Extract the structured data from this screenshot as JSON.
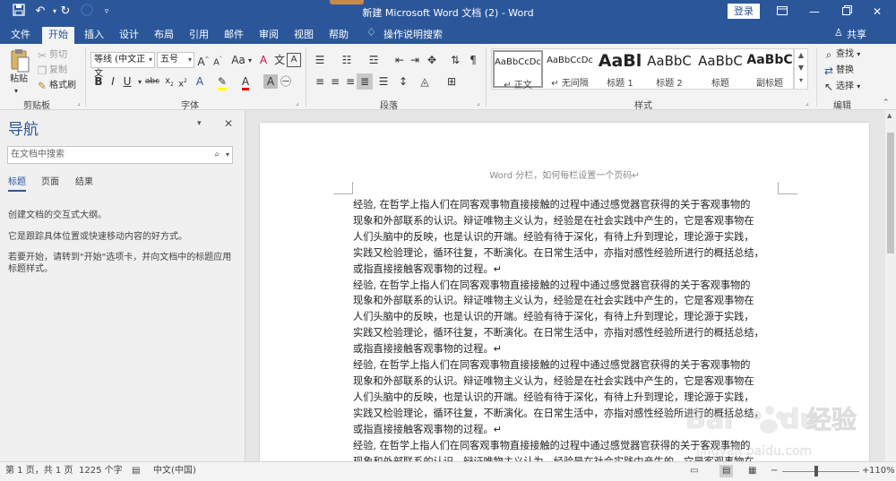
{
  "titlebar": {
    "title": "新建 Microsoft Word 文档 (2)  -  Word",
    "login": "登录",
    "quick_access": [
      "save-icon",
      "undo-icon",
      "redo-icon",
      "touch-mode-icon",
      "customize-icon"
    ]
  },
  "tabs": [
    "文件",
    "开始",
    "插入",
    "设计",
    "布局",
    "引用",
    "邮件",
    "审阅",
    "视图",
    "帮助"
  ],
  "active_tab": "开始",
  "tell_me": "操作说明搜索",
  "share": "共享",
  "ribbon": {
    "clipboard": {
      "label": "剪贴板",
      "paste": "粘贴",
      "cut": "剪切",
      "copy": "复制",
      "format_painter": "格式刷"
    },
    "font": {
      "label": "字体",
      "font_name": "等线 (中文正文",
      "font_size": "五号",
      "aa": "Aa"
    },
    "paragraph": {
      "label": "段落"
    },
    "styles": {
      "label": "样式",
      "items": [
        {
          "preview": "AaBbCcDc",
          "name": "正文"
        },
        {
          "preview": "AaBbCcDc",
          "name": "无间隔"
        },
        {
          "preview": "AaBl",
          "name": "标题 1"
        },
        {
          "preview": "AaBbC",
          "name": "标题 2"
        },
        {
          "preview": "AaBbC",
          "name": "标题"
        },
        {
          "preview": "AaBbC",
          "name": "副标题"
        }
      ]
    },
    "editing": {
      "label": "编辑",
      "find": "查找",
      "replace": "替换",
      "select": "选择"
    }
  },
  "nav": {
    "title": "导航",
    "search_placeholder": "在文档中搜索",
    "tabs": [
      "标题",
      "页面",
      "结果"
    ],
    "msg1": "创建文档的交互式大纲。",
    "msg2": "它是跟踪具体位置或快速移动内容的好方式。",
    "msg3": "若要开始，请转到\"开始\"选项卡，并向文档中的标题应用标题样式。"
  },
  "document": {
    "header": "Word 分栏，如何每栏设置一个页码↵",
    "lines": [
      "经验, 在哲学上指人们在同客观事物直接接触的过程中通过感觉器官获得的关于客观事物的",
      "现象和外部联系的认识。辩证唯物主义认为，经验是在社会实践中产生的，它是客观事物在",
      "人们头脑中的反映，也是认识的开端。经验有待于深化，有待上升到理论，理论源于实践，",
      "实践又检验理论，循环往复，不断演化。在日常生活中，亦指对感性经验所进行的概括总结，",
      "或指直接接触客观事物的过程。↵"
    ],
    "partial_last": "现象和外部联系的认识。辩证唯物主义认为，经验是在社会实践中产生的，它是客观事物在"
  },
  "status": {
    "page": "第 1 页，共 1 页",
    "words": "1225 个字",
    "language": "中文(中国)",
    "zoom": "110%"
  },
  "watermark": {
    "brand": "Baidu",
    "cn": "经验",
    "url": "jingyan.baidu.com"
  }
}
